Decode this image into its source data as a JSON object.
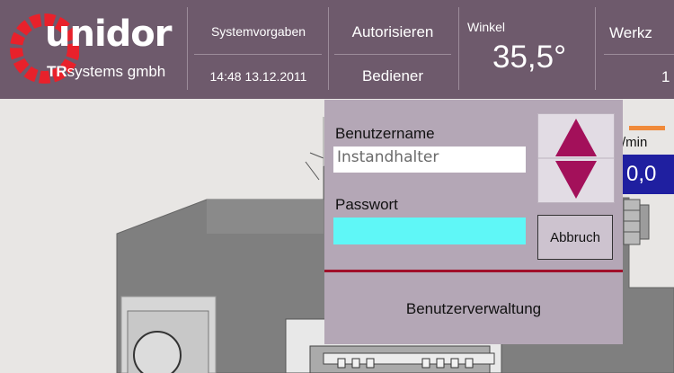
{
  "logo": {
    "brand": "unidor",
    "sub_bold": "TR",
    "sub_rest": "systems gmbh"
  },
  "header": {
    "systemvorgaben": "Systemvorgaben",
    "datetime": "14:48 13.12.2011",
    "autorisieren": "Autorisieren",
    "bediener": "Bediener",
    "winkel_label": "Winkel",
    "winkel_value": "35,5°",
    "werkzeug_label": "Werkz",
    "werkzeug_value": "1"
  },
  "gauge": {
    "unit": "/min",
    "value": "0,0"
  },
  "dialog": {
    "username_label": "Benutzername",
    "username_value": "Instandhalter",
    "password_label": "Passwort",
    "password_value": "",
    "cancel_label": "Abbruch",
    "admin_label": "Benutzerverwaltung"
  },
  "colors": {
    "header_bg": "#6e5a6c",
    "dialog_bg": "#b4a7b6",
    "accent_red": "#a0102a",
    "arrow": "#a3105a",
    "password_field": "#5ff7f7",
    "value_box": "#1f1fa0"
  }
}
